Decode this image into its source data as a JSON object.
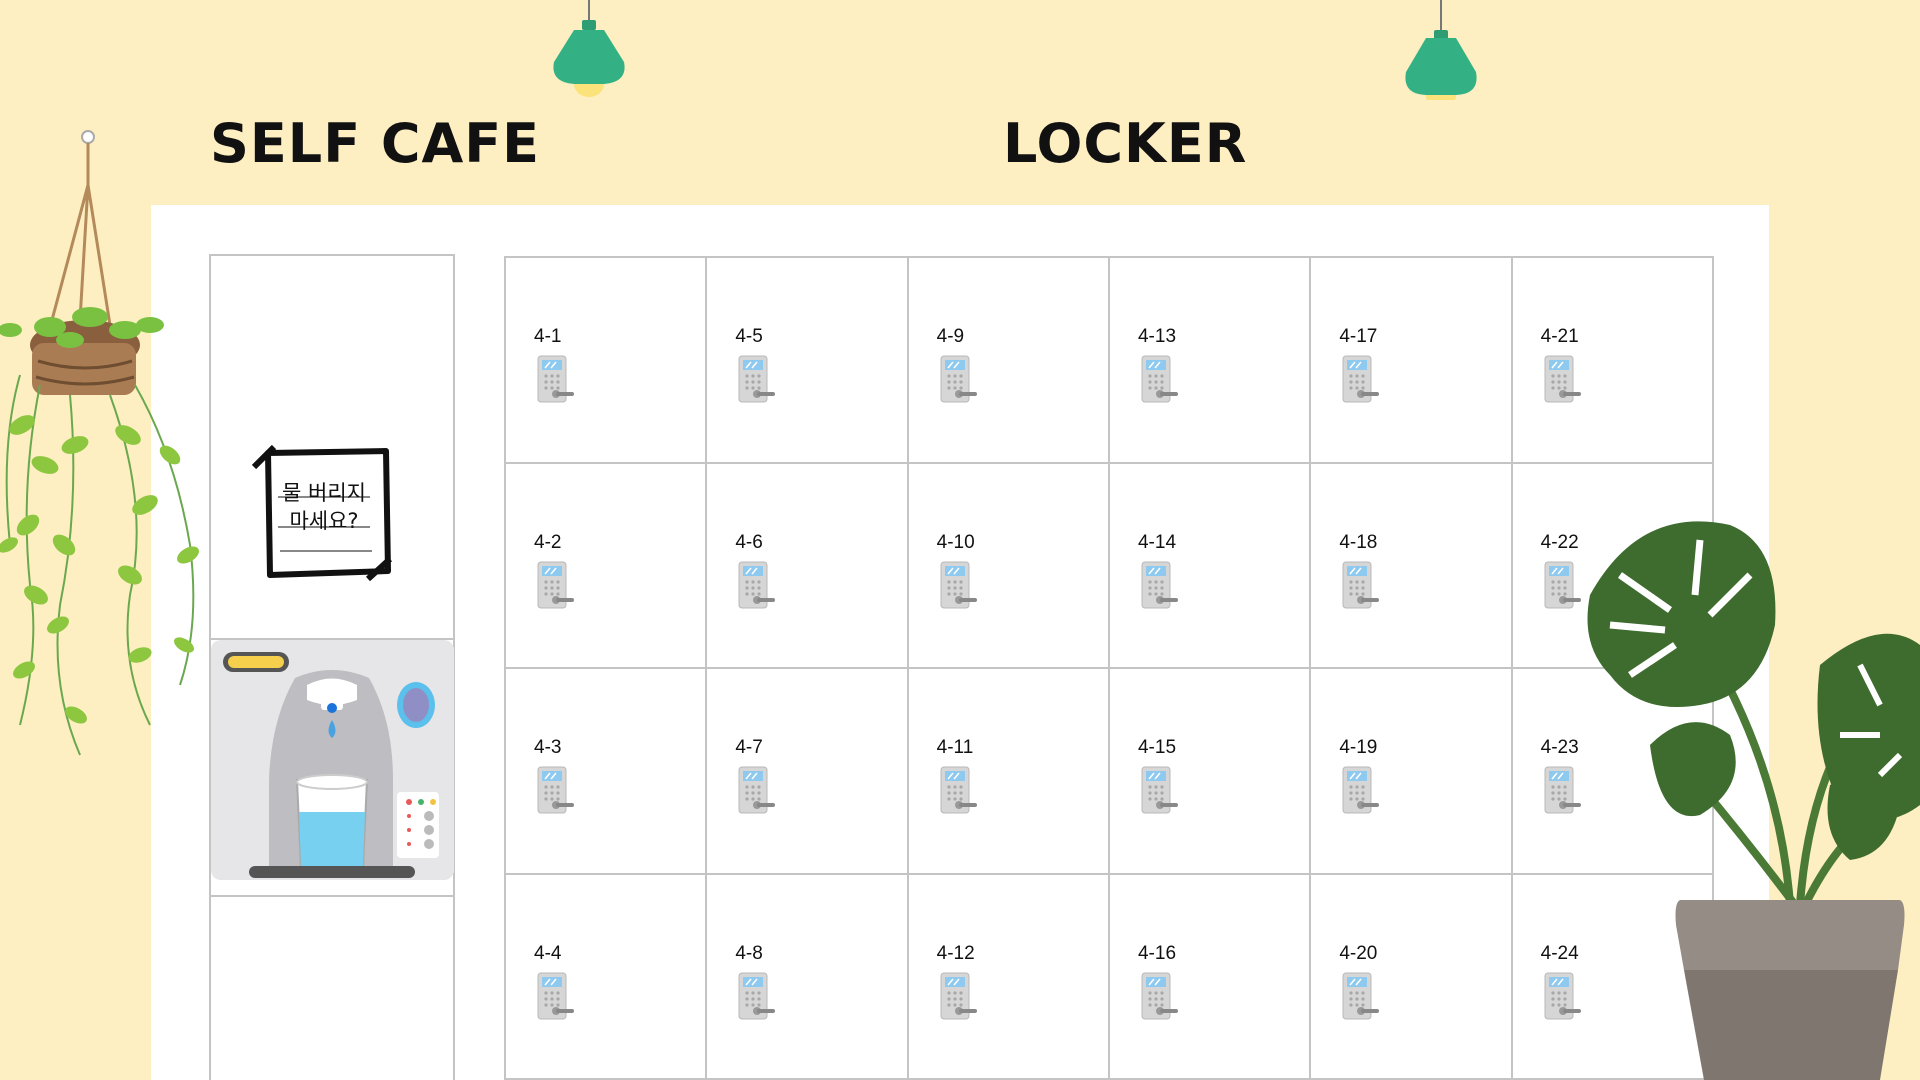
{
  "headings": {
    "cafe": "SELF CAFE",
    "locker": "LOCKER"
  },
  "cafe": {
    "sign_line1": "물 버리지",
    "sign_line2": "마세요?",
    "dispenser_icon": "water-dispenser"
  },
  "lockers": [
    [
      "4-1",
      "4-5",
      "4-9",
      "4-13",
      "4-17",
      "4-21"
    ],
    [
      "4-2",
      "4-6",
      "4-10",
      "4-14",
      "4-18",
      "4-22"
    ],
    [
      "4-3",
      "4-7",
      "4-11",
      "4-15",
      "4-19",
      "4-23"
    ],
    [
      "4-4",
      "4-8",
      "4-12",
      "4-16",
      "4-20",
      "4-24"
    ]
  ],
  "colors": {
    "background": "#fdefc1",
    "lamp": "#34b184",
    "bulb": "#fbe27a",
    "monstera": "#3e6b2e",
    "pot": "#958d85",
    "pothos": "#7ac142"
  }
}
